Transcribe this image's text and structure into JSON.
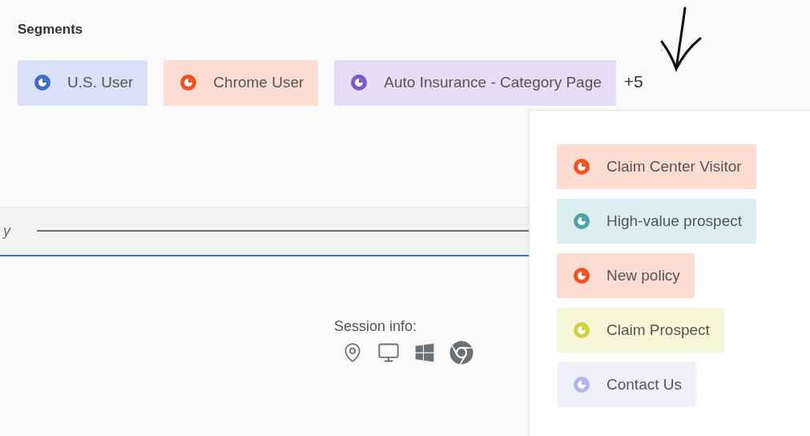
{
  "section_title": "Segments",
  "segments": [
    {
      "label": "U.S. User",
      "color": "#3d6bd0"
    },
    {
      "label": "Chrome User",
      "color": "#f4511e"
    },
    {
      "label": "Auto Insurance - Category Page",
      "color": "#7e57c2"
    }
  ],
  "more_count": "+5",
  "popup": {
    "segments": [
      {
        "label": "Claim Center Visitor",
        "color": "#f4511e"
      },
      {
        "label": "High-value prospect",
        "color": "#4aa3a8"
      },
      {
        "label": "New policy",
        "color": "#f4511e"
      },
      {
        "label": "Claim Prospect",
        "color": "#d4d040"
      },
      {
        "label": "Contact Us",
        "color": "#b4b4ec"
      }
    ]
  },
  "filter_bar": {
    "partial_label": "y"
  },
  "session_info": {
    "label": "Session info:"
  }
}
